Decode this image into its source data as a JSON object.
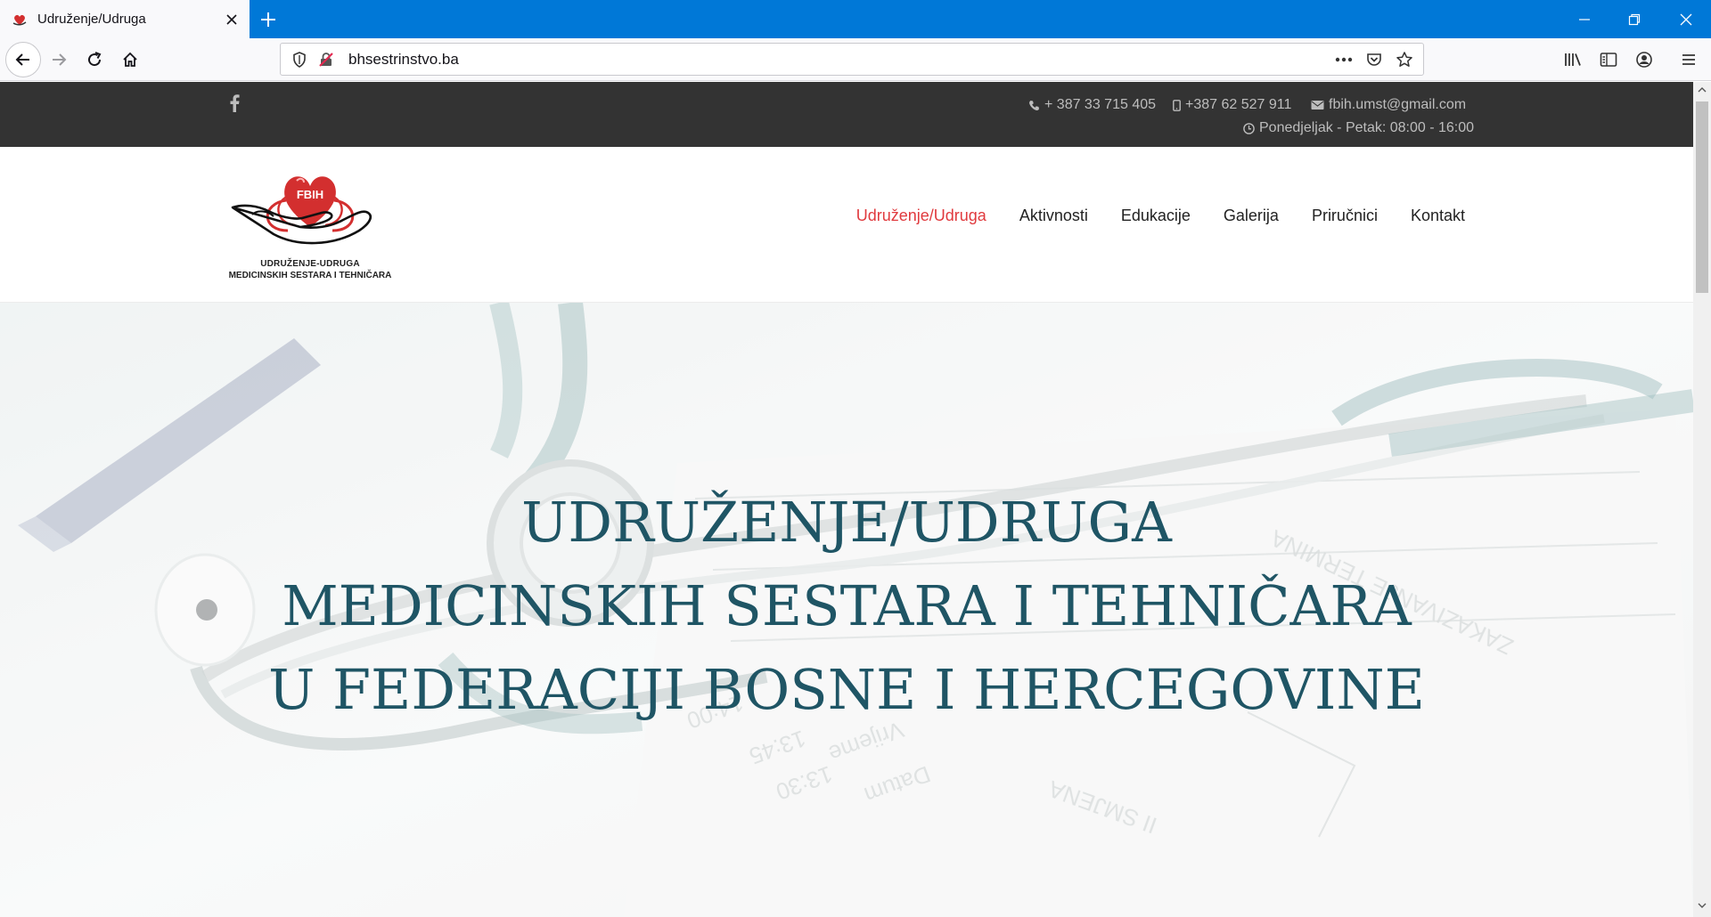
{
  "browser": {
    "tab_title": "Udruženje/Udruga",
    "url": "bhsestrinstvo.ba"
  },
  "topbar": {
    "phone1": "+ 387 33 715 405",
    "phone2": "+387 62 527 911",
    "email": "fbih.umst@gmail.com",
    "hours": "Ponedjeljak - Petak: 08:00 - 16:00"
  },
  "logo": {
    "badge": "FBIH",
    "line1": "UDRUŽENJE-UDRUGA",
    "line2": "MEDICINSKIH SESTARA I TEHNIČARA"
  },
  "menu": [
    {
      "label": "Udruženje/Udruga",
      "active": true
    },
    {
      "label": "Aktivnosti"
    },
    {
      "label": "Edukacije"
    },
    {
      "label": "Galerija"
    },
    {
      "label": "Priručnici"
    },
    {
      "label": "Kontakt"
    }
  ],
  "hero": {
    "line1": "UDRUŽENJE/UDRUGA",
    "line2": "MEDICINSKIH SESTARA I TEHNIČARA",
    "line3": "U FEDERACIJI BOSNE I HERCEGOVINE"
  },
  "colors": {
    "browser_accent": "#0078d7",
    "topbar_bg": "#333333",
    "menu_active": "#e03a3e",
    "hero_title": "#1f5565"
  }
}
